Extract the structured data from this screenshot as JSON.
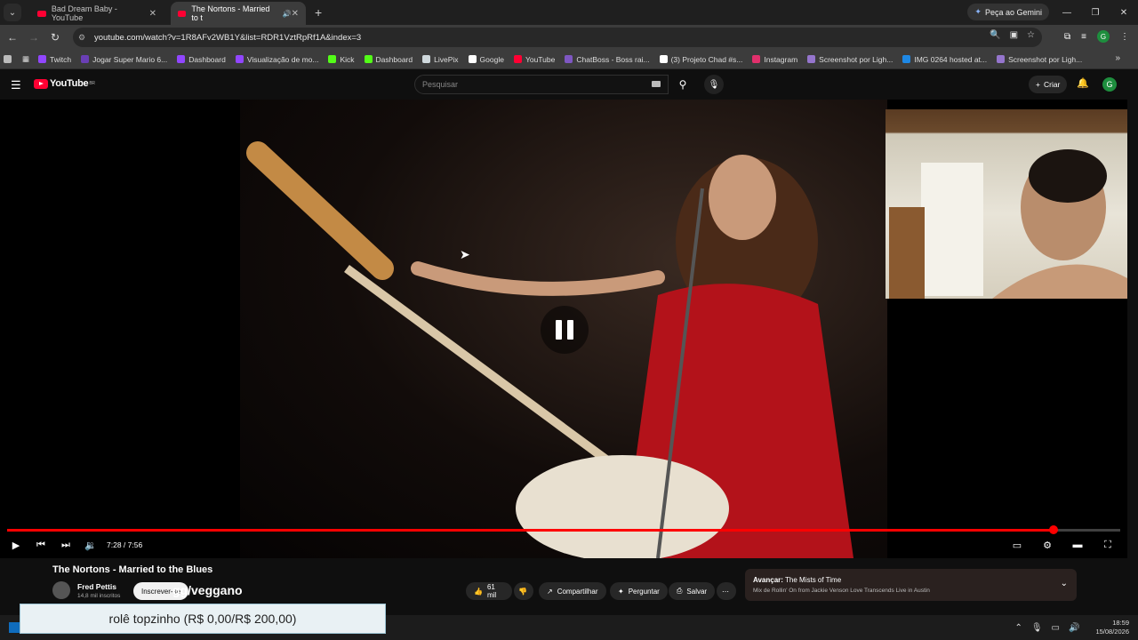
{
  "browser": {
    "tabs": [
      {
        "label": "Bad Dream Baby - YouTube",
        "active": false
      },
      {
        "label": "The Nortons - Married to t",
        "active": true
      }
    ],
    "gemini_label": "Peça ao Gemini",
    "url": "youtube.com/watch?v=1R8AFv2WB1Y&list=RDR1VztRpRf1A&index=3",
    "profile_initial": "G"
  },
  "bookmarks": [
    {
      "label": "Twitch",
      "color": "#9146ff"
    },
    {
      "label": "Jogar Super Mario 6...",
      "color": "#6a3fb5"
    },
    {
      "label": "Dashboard",
      "color": "#9146ff"
    },
    {
      "label": "Visualização de mo...",
      "color": "#9146ff"
    },
    {
      "label": "Kick",
      "color": "#53fc18"
    },
    {
      "label": "Dashboard",
      "color": "#53fc18"
    },
    {
      "label": "LivePix",
      "color": "#cfd8dc"
    },
    {
      "label": "Google",
      "color": "#ffffff"
    },
    {
      "label": "YouTube",
      "color": "#ff0033"
    },
    {
      "label": "ChatBoss - Boss rai...",
      "color": "#7e57c2"
    },
    {
      "label": "(3) Projeto Chad #s...",
      "color": "#ffffff"
    },
    {
      "label": "Instagram",
      "color": "#e1306c"
    },
    {
      "label": "Screenshot por Ligh...",
      "color": "#9575cd"
    },
    {
      "label": "IMG 0264 hosted at...",
      "color": "#1e88e5"
    },
    {
      "label": "Screenshot por Ligh...",
      "color": "#9575cd"
    }
  ],
  "youtube": {
    "logo_text": "YouTube",
    "logo_region": "BR",
    "search_placeholder": "Pesquisar",
    "create_label": "Criar",
    "avatar_initial": "G"
  },
  "player": {
    "time_display": "7:28 / 7:56",
    "progress_fraction": 0.94
  },
  "video": {
    "title": "The Nortons - Married to the Blues",
    "channel_name": "Fred Pettis",
    "subscribers": "14,8 mil inscritos",
    "subscribe_label": "Inscrever-se",
    "overlay_text": "gg/veggano",
    "likes": "61 mil",
    "share_label": "Compartilhar",
    "ask_label": "Perguntar",
    "save_label": "Salvar",
    "next_prefix": "Avançar:",
    "next_title": "The Mists of Time",
    "next_subtitle": "Mix de Rollin' On from Jackie Venson Love Transcends Live in Austin"
  },
  "overlay_goal": {
    "text": "rolê topzinho (R$ 0,00/R$ 200,00)"
  },
  "taskbar": {
    "time": "18:59",
    "date": "15/08/2026"
  },
  "colors": {
    "accent_red": "#ff0000",
    "yt_red": "#ff0033",
    "page_bg": "#0f0f0f"
  }
}
